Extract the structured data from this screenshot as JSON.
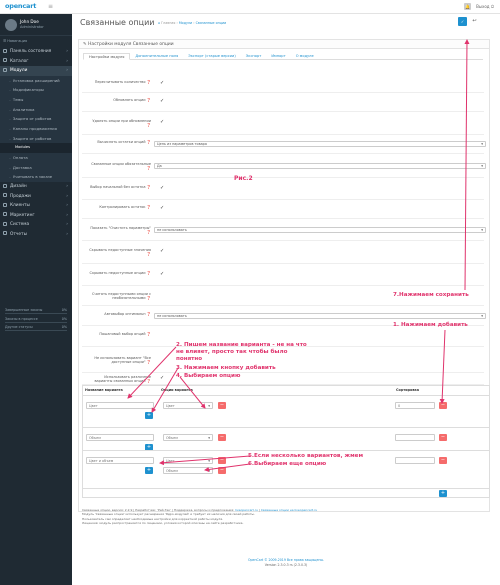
{
  "header": {
    "logo_text": "opencart",
    "logout_label": "Выход"
  },
  "sidebar": {
    "user_name": "John Doe",
    "user_role": "Administrator",
    "search_label": "Навигация",
    "items": [
      {
        "label": "Панель состояния",
        "type": "top"
      },
      {
        "label": "Каталог",
        "type": "top"
      },
      {
        "label": "Модули",
        "type": "active"
      },
      {
        "label": "Установка расширений",
        "type": "sub"
      },
      {
        "label": "Модификаторы",
        "type": "sub"
      },
      {
        "label": "Темы",
        "type": "sub"
      },
      {
        "label": "Аналитика",
        "type": "sub"
      },
      {
        "label": "Защита от роботов",
        "type": "sub"
      },
      {
        "label": "Каналы продвижения",
        "type": "sub"
      },
      {
        "label": "Защита от роботов",
        "type": "sub"
      },
      {
        "label": "Modules",
        "type": "subsub"
      },
      {
        "label": "Оплата",
        "type": "sub"
      },
      {
        "label": "Доставка",
        "type": "sub"
      },
      {
        "label": "Учитывать в заказе",
        "type": "sub"
      },
      {
        "label": "Дизайн",
        "type": "top"
      },
      {
        "label": "Продажи",
        "type": "top"
      },
      {
        "label": "Клиенты",
        "type": "top"
      },
      {
        "label": "Маркетинг",
        "type": "top"
      },
      {
        "label": "Система",
        "type": "top"
      },
      {
        "label": "Отчеты",
        "type": "top"
      }
    ],
    "stats": [
      {
        "label": "Завершенные заказы",
        "percent": "0%",
        "fill": 0.0
      },
      {
        "label": "Заказы в процессе",
        "percent": "0%",
        "fill": 0.0
      },
      {
        "label": "Другие статусы",
        "percent": "0%",
        "fill": 0.0
      }
    ]
  },
  "page": {
    "title": "Связанные опции",
    "breadcrumb_home": "Главная",
    "breadcrumb_sep1": "Модули",
    "breadcrumb_current": "Связанные опции",
    "panel_title": "Настройки модуля Связанные опции"
  },
  "tabs": [
    "Настройки модуля",
    "Дополнительные поля",
    "Экспорт (старые версии)",
    "Экспорт",
    "Импорт",
    "О модуле"
  ],
  "settings": [
    {
      "label": "Пересчитывать количество",
      "value": "✓"
    },
    {
      "label": "Обновлять опции",
      "value": "✓"
    },
    {
      "label": "Удалять опции при обновлении",
      "value": "✓"
    },
    {
      "label": "Вычислять остатки опций",
      "value": "Цепь из параметров товара",
      "kind": "select"
    },
    {
      "label": "Связанные опции обязательные",
      "value": "Да",
      "kind": "select"
    },
    {
      "label": "Выбор начальной без остатка",
      "value": "✓"
    },
    {
      "label": "Контролировать остаток",
      "value": "✓"
    },
    {
      "label": "Показать \"Очистить параметры\"",
      "value": "не использовать",
      "kind": "select"
    },
    {
      "label": "Скрывать недоступные значения",
      "value": "✓"
    },
    {
      "label": "Скрывать недоступные опции",
      "value": "✓"
    },
    {
      "label": "Считать недоступными опции с необязательными",
      "value": ""
    },
    {
      "label": "Автовыбор оптимальн",
      "value": "не использовать",
      "kind": "select"
    },
    {
      "label": "Пошаговый выбор опций",
      "value": ""
    },
    {
      "label": "Не использовать вариант \"Все доступные опции\"",
      "value": ""
    },
    {
      "label": "Использовать различные варианты связанных опций",
      "value": "✓"
    }
  ],
  "annotations": {
    "fig": "Рис.2",
    "n1": "1. Нажимаем добавить",
    "n2": "2. Пишем название варианта - не на что",
    "n2b": "не влияет, просто так чтобы было",
    "n2c": "понятно",
    "n3": "3. Нажимаем кнопку добавить",
    "n4": "4. Выбираем опцию",
    "n5": "5.Если несколько вариантов, жмем",
    "n6": "6.Выбираем еще опцию",
    "n7": "7.Нажимаем сохранить"
  },
  "variants_table": {
    "col_name": "Название варианта",
    "col_options": "Опции варианта",
    "col_sort": "Сортировка",
    "rows": [
      {
        "name": "Цвет",
        "option": "Цвет",
        "sort": "0"
      },
      {
        "name": "Объем",
        "option": "Объем",
        "sort": ""
      },
      {
        "name": "Цвет и объем",
        "option": "Цвет",
        "option2": "Объем",
        "sort": ""
      }
    ]
  },
  "footer": {
    "line1": "Связанные опции, версия: 2.2.9 | Разработчик: 'Рей-Тек' | Поддержка, вопросы и предложения:",
    "email": "liveopencart.ru",
    "link": "Связанные опции на liveopencart.ru",
    "line2": "Модуль 'Связанные опции' использует расширения 'Ядро-модулей' и требует их наличия для своей работы.",
    "line3": "Пользователь сам определяет необходимые настройки для корректной работы модуля.",
    "line4": "Лицензия: модуль распространяется по лицензии, условия которой описаны на сайте разработчика.",
    "copy1": "OpenCart © 2009-2019 Все права защищены.",
    "copy2": "Version 2.3.0.3 rs (2.3.0.3)"
  },
  "colors": {
    "accent": "#1e91cf",
    "danger": "#f56b6b",
    "annotation": "#e0336c",
    "sidebar": "#1f2a33"
  }
}
